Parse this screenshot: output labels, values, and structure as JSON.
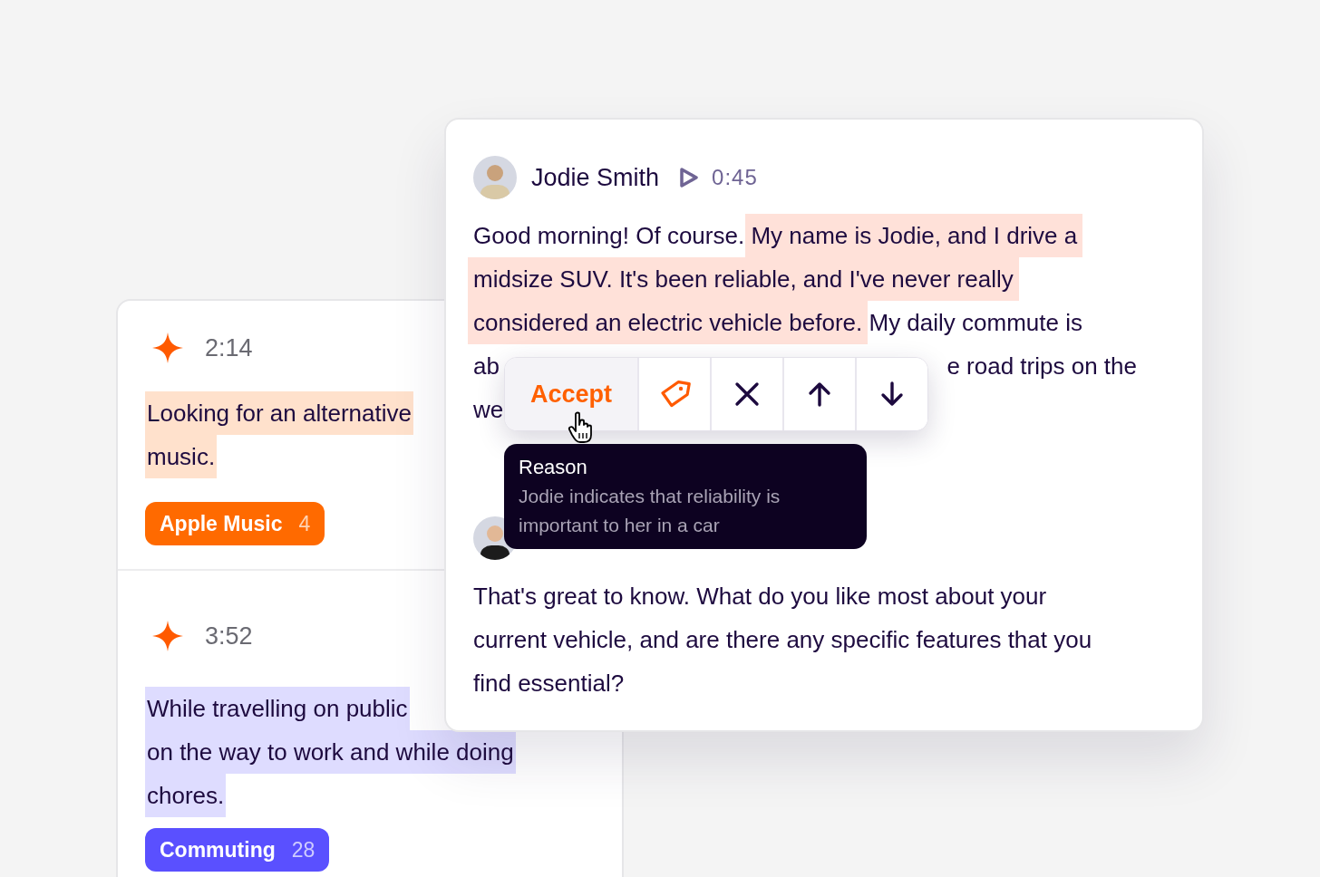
{
  "highlights": [
    {
      "time": "2:14",
      "lines": [
        "Looking for an alternative",
        "music."
      ],
      "tag": {
        "label": "Apple Music",
        "count": "4",
        "color": "#ff6a00"
      }
    },
    {
      "time": "3:52",
      "lines": [
        "While travelling on public",
        "on the way to work and while doing",
        "chores."
      ],
      "tag": {
        "label": "Commuting",
        "count": "28",
        "color": "#5a50ff"
      }
    }
  ],
  "transcript": [
    {
      "speaker": "Jodie Smith",
      "time": "0:45",
      "lines": [
        [
          {
            "text": "Good morning! Of course. ",
            "highlighted": false
          },
          {
            "text": "My name is Jodie, and I drive a",
            "highlighted": true
          }
        ],
        [
          {
            "text": "midsize SUV. It's been reliable, and I've never really",
            "highlighted": true
          }
        ],
        [
          {
            "text": "considered an electric vehicle before.",
            "highlighted": true
          },
          {
            "text": " My daily commute is",
            "highlighted": false
          }
        ],
        [
          {
            "text": "ab",
            "highlighted": false
          },
          {
            "text": "e road trips on the",
            "highlighted": false
          }
        ],
        [
          {
            "text": "we",
            "highlighted": false
          }
        ]
      ]
    },
    {
      "lines": [
        [
          {
            "text": "That's great to know. What do you like most about your",
            "highlighted": false
          }
        ],
        [
          {
            "text": "current vehicle, and are there any specific features that you",
            "highlighted": false
          }
        ],
        [
          {
            "text": "find essential?",
            "highlighted": false
          }
        ]
      ]
    }
  ],
  "toolbar": {
    "accept": "Accept"
  },
  "tooltip": {
    "title": "Reason",
    "body": "Jodie indicates that reliability is important to her in a car"
  }
}
